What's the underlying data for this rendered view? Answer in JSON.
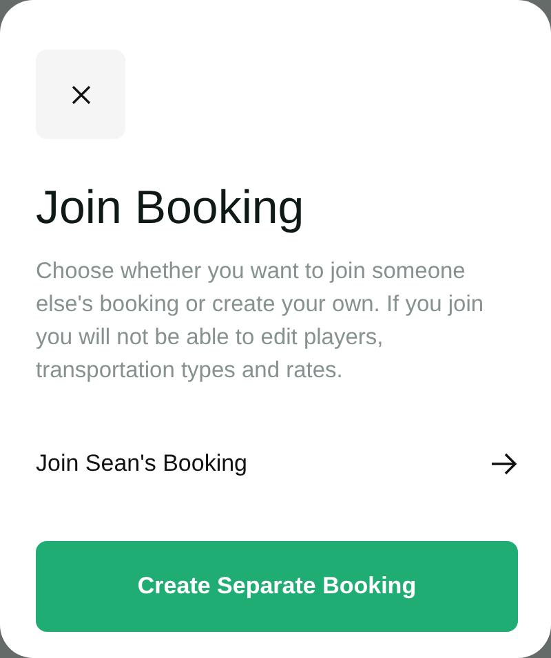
{
  "title": "Join Booking",
  "description": "Choose whether you want to join someone else's booking or create your own. If you join you will not be able to edit players, transportation types and rates.",
  "option": {
    "label": "Join Sean's Booking"
  },
  "primary_button": {
    "label": "Create Separate Booking"
  }
}
